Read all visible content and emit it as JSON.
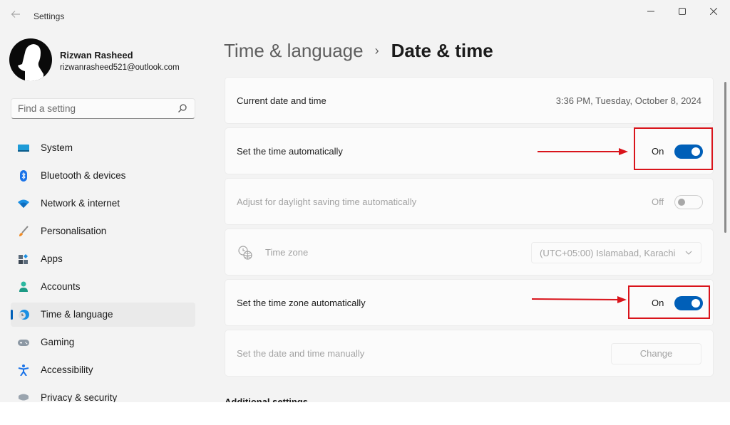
{
  "window": {
    "title": "Settings",
    "back_icon": "back-arrow-icon",
    "controls": [
      "minimize-icon",
      "maximize-icon",
      "close-icon"
    ]
  },
  "profile": {
    "name": "Rizwan Rasheed",
    "email": "rizwanrasheed521@outlook.com"
  },
  "search": {
    "placeholder": "Find a setting"
  },
  "sidebar": {
    "items": [
      {
        "label": "System",
        "icon": "monitor-icon"
      },
      {
        "label": "Bluetooth & devices",
        "icon": "bluetooth-icon"
      },
      {
        "label": "Network & internet",
        "icon": "wifi-icon"
      },
      {
        "label": "Personalisation",
        "icon": "paintbrush-icon"
      },
      {
        "label": "Apps",
        "icon": "apps-icon"
      },
      {
        "label": "Accounts",
        "icon": "person-icon"
      },
      {
        "label": "Time & language",
        "icon": "globe-clock-icon",
        "active": true
      },
      {
        "label": "Gaming",
        "icon": "gamepad-icon"
      },
      {
        "label": "Accessibility",
        "icon": "accessibility-icon"
      },
      {
        "label": "Privacy & security",
        "icon": "shield-icon"
      }
    ]
  },
  "header": {
    "parent": "Time & language",
    "separator": "›",
    "current": "Date & time"
  },
  "settings": {
    "current_datetime": {
      "label": "Current date and time",
      "value": "3:36 PM, Tuesday, October 8, 2024"
    },
    "set_time_auto": {
      "label": "Set the time automatically",
      "state": "On"
    },
    "daylight_saving": {
      "label": "Adjust for daylight saving time automatically",
      "state": "Off"
    },
    "time_zone": {
      "label": "Time zone",
      "selected": "(UTC+05:00) Islamabad, Karachi"
    },
    "set_timezone_auto": {
      "label": "Set the time zone automatically",
      "state": "On"
    },
    "set_manual": {
      "label": "Set the date and time manually",
      "button": "Change"
    }
  },
  "next_section": {
    "title": "Additional settings"
  },
  "colors": {
    "accent": "#005fb8",
    "annotation": "#d9141b"
  }
}
